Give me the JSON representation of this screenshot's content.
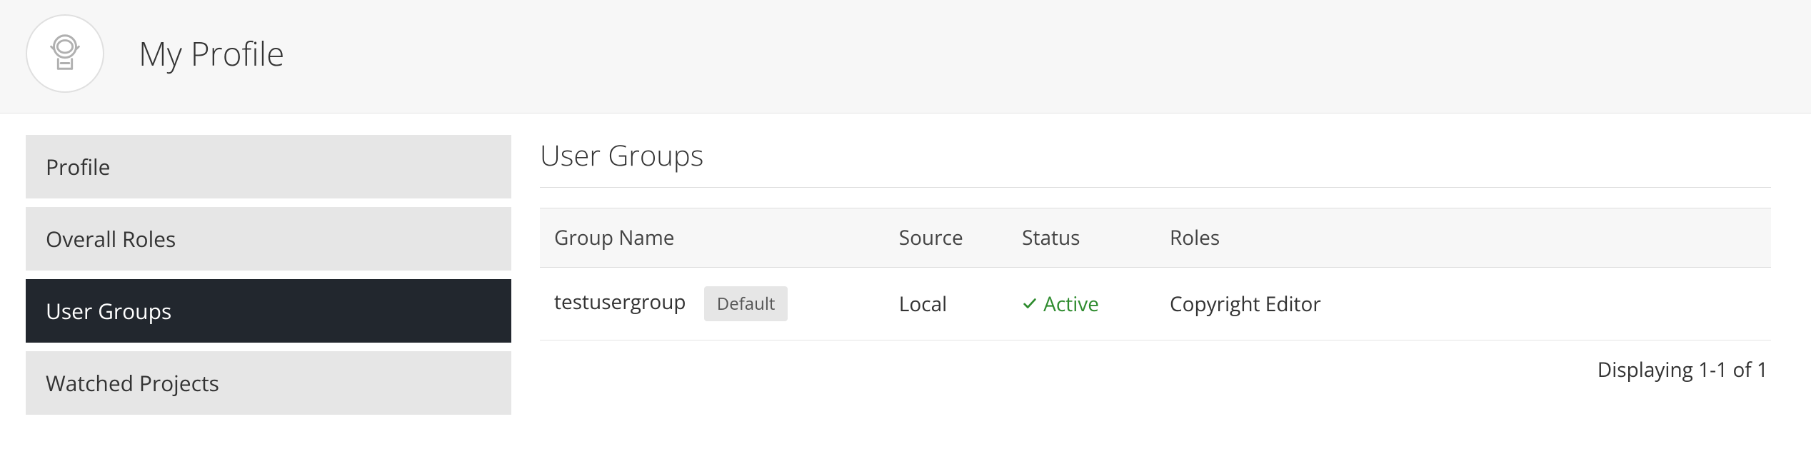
{
  "header": {
    "title": "My Profile"
  },
  "sidebar": {
    "items": [
      {
        "label": "Profile",
        "active": false
      },
      {
        "label": "Overall Roles",
        "active": false
      },
      {
        "label": "User Groups",
        "active": true
      },
      {
        "label": "Watched Projects",
        "active": false
      }
    ]
  },
  "main": {
    "section_title": "User Groups",
    "table": {
      "columns": {
        "group_name": "Group Name",
        "source": "Source",
        "status": "Status",
        "roles": "Roles"
      },
      "rows": [
        {
          "group_name": "testusergroup",
          "badge": "Default",
          "source": "Local",
          "status": "Active",
          "status_color": "#2e8b2e",
          "roles": "Copyright Editor"
        }
      ]
    },
    "pager_text": "Displaying 1-1 of 1"
  }
}
